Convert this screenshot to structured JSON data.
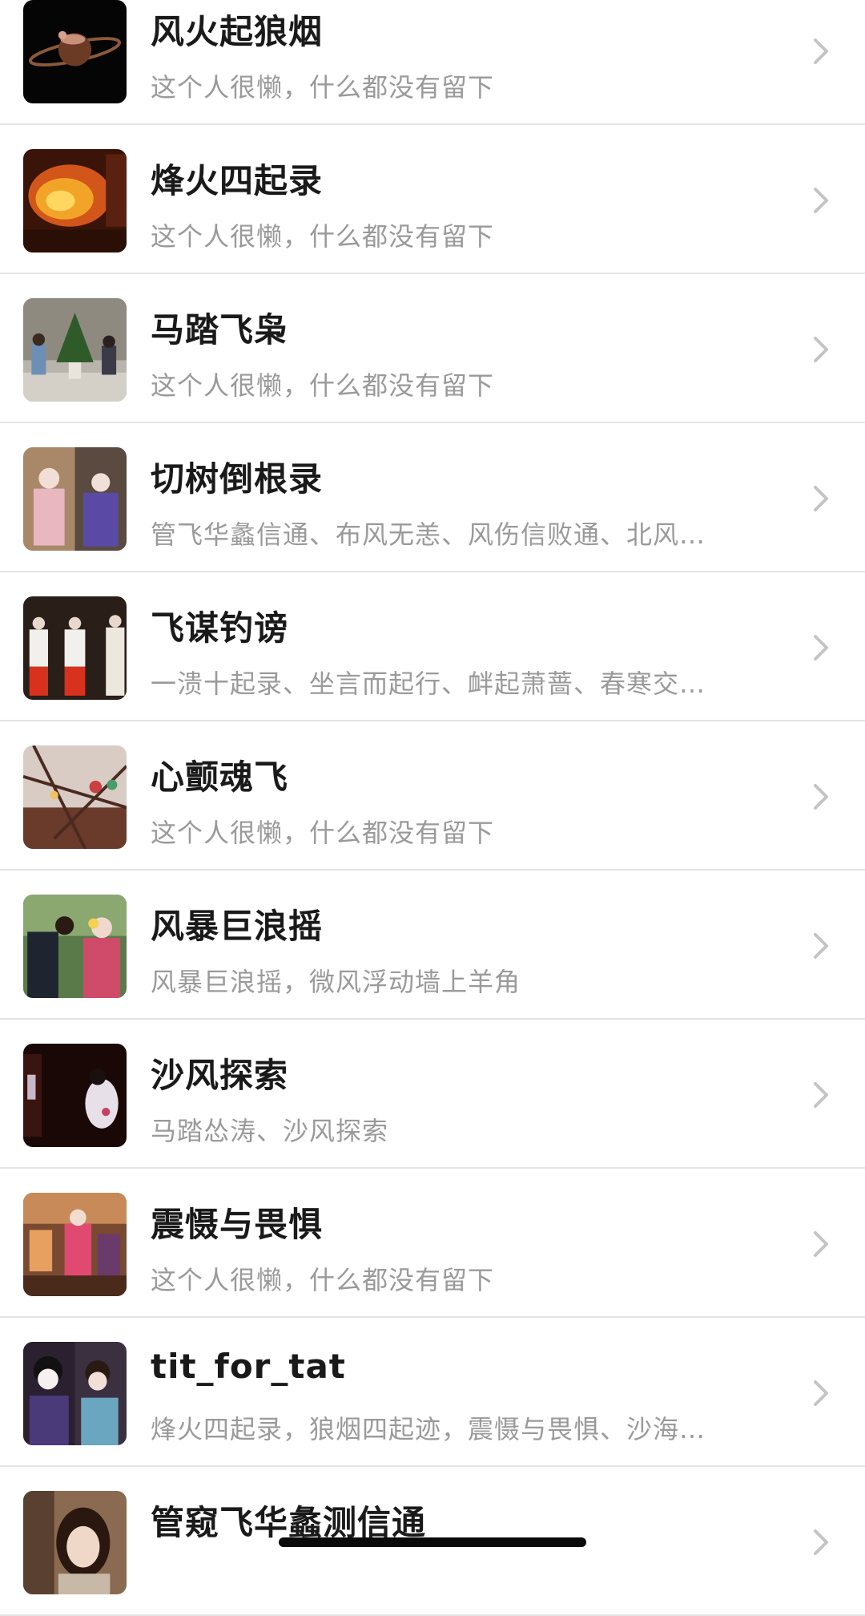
{
  "colors": {
    "title": "#1a1a1a",
    "subtitle": "#9a9a9a",
    "divider": "#e4e4e4",
    "chevron": "#c4c4c4",
    "home_indicator": "#0a0a0a"
  },
  "list": {
    "items": [
      {
        "title": "风火起狼烟",
        "subtitle": "这个人很懒，什么都没有留下",
        "avatar_icon": "saturn-figure-avatar"
      },
      {
        "title": "烽火四起录",
        "subtitle": "这个人很懒，什么都没有留下",
        "avatar_icon": "fire-avatar"
      },
      {
        "title": "马踏飞枭",
        "subtitle": "这个人很懒，什么都没有留下",
        "avatar_icon": "christmas-tree-avatar"
      },
      {
        "title": "切树倒根录",
        "subtitle": "管飞华蠡信通、布风无恙、风伤信败通、北风…",
        "avatar_icon": "kimono-pair-avatar"
      },
      {
        "title": "飞谋钓谤",
        "subtitle": "一溃十起录、坐言而起行、衅起萧蔷、春寒交…",
        "avatar_icon": "shrine-maidens-avatar"
      },
      {
        "title": "心颤魂飞",
        "subtitle": "这个人很懒，什么都没有留下",
        "avatar_icon": "blossom-branches-avatar"
      },
      {
        "title": "风暴巨浪摇",
        "subtitle": "风暴巨浪摇，微风浮动墙上羊角",
        "avatar_icon": "couple-garden-avatar"
      },
      {
        "title": "沙风探索",
        "subtitle": "马踏怂涛、沙风探索",
        "avatar_icon": "night-figure-avatar"
      },
      {
        "title": "震慑与畏惧",
        "subtitle": "这个人很懒，什么都没有留下",
        "avatar_icon": "temple-interior-avatar"
      },
      {
        "title": "tit_for_tat",
        "subtitle": "烽火四起录，狼烟四起迹，震慑与畏惧、沙海…",
        "avatar_icon": "geisha-portrait-avatar"
      },
      {
        "title": "管窥飞华蠡测信通",
        "subtitle": "",
        "avatar_icon": "woman-portrait-avatar"
      }
    ]
  }
}
